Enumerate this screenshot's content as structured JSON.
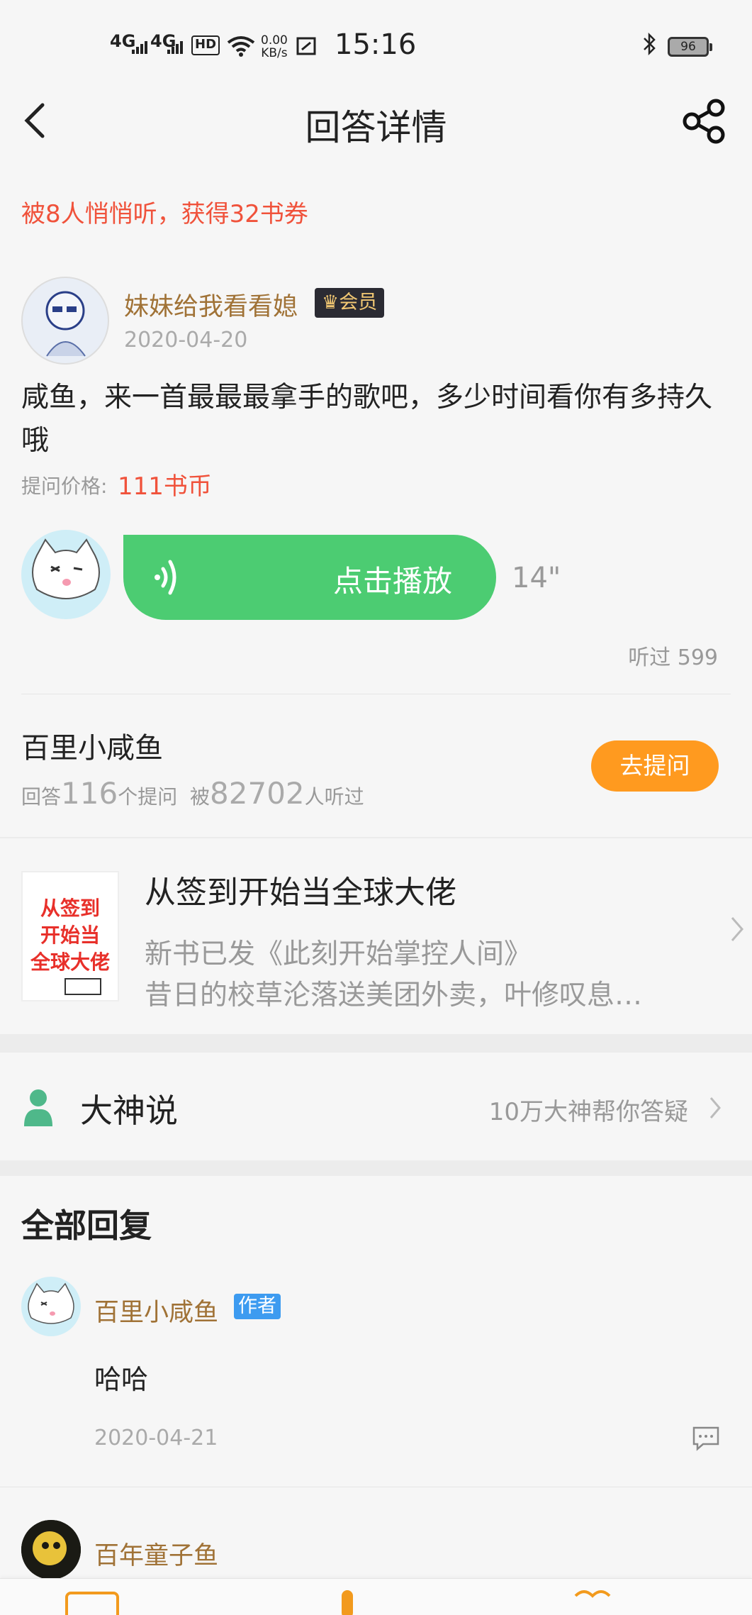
{
  "status_bar": {
    "signal1": "4G",
    "signal2": "4G",
    "hd": "HD",
    "net_speed_value": "0.00",
    "net_speed_unit": "KB/s",
    "time": "15:16",
    "battery": "96"
  },
  "nav": {
    "title": "回答详情",
    "back_icon": "back-arrow-icon",
    "share_icon": "share-icon"
  },
  "notice": "被8人悄悄听，获得32书券",
  "question": {
    "user_name": "妹妹给我看看媳",
    "vip_label": "会员",
    "date": "2020-04-20",
    "text": "咸鱼，来一首最最最拿手的歌吧，多少时间看你有多持久哦",
    "price_label": "提问价格:",
    "price_value": "111书币"
  },
  "voice": {
    "play_label": "点击播放",
    "duration": "14\"",
    "listened": "听过 599"
  },
  "answerer": {
    "name": "百里小咸鱼",
    "answers_prefix": "回答",
    "answers_count": "116",
    "answers_suffix": "个提问",
    "listen_prefix": "被",
    "listen_count": "82702",
    "listen_suffix": "人听过",
    "ask_button": "去提问"
  },
  "book": {
    "title": "从签到开始当全球大佬",
    "line1": "新书已发《此刻开始掌控人间》",
    "line2": "昔日的校草沦落送美团外卖，叶修叹息…",
    "cover_text": "从签到开始当全球大佬"
  },
  "gods": {
    "title": "大神说",
    "hint": "10万大神帮你答疑"
  },
  "replies": {
    "title": "全部回复",
    "items": [
      {
        "name": "百里小咸鱼",
        "badge": "作者",
        "text": "哈哈",
        "date": "2020-04-21"
      },
      {
        "name": "百年童子鱼"
      }
    ]
  },
  "colors": {
    "accent_red": "#f0523b",
    "play_green": "#4ccc72",
    "ask_orange": "#ff9a1f",
    "name_brown": "#a07236",
    "author_blue": "#3d9bf0"
  }
}
